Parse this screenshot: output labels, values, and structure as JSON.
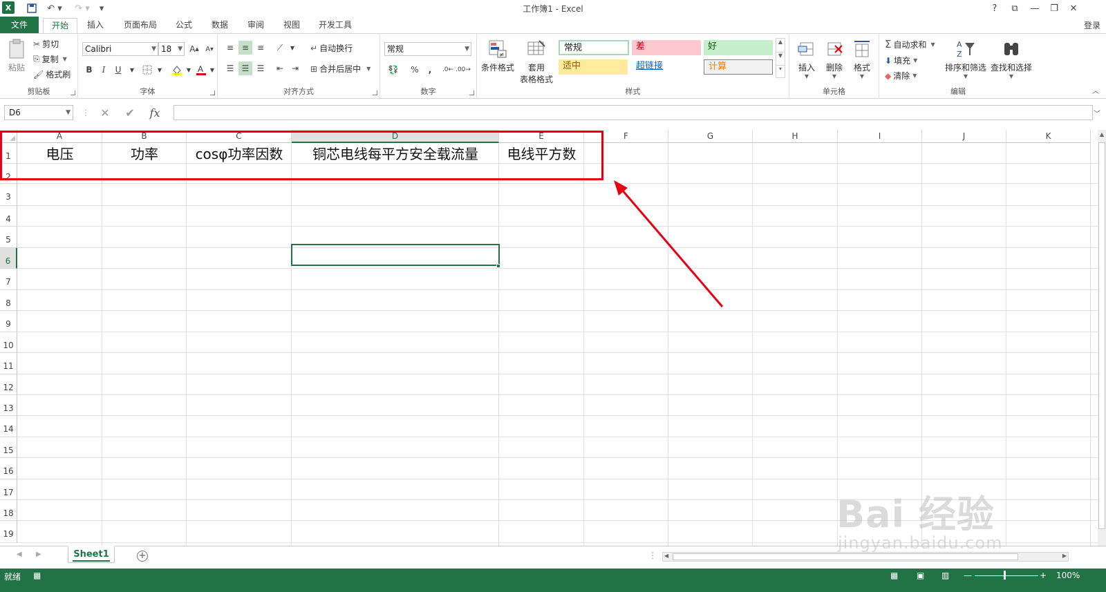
{
  "window": {
    "title": "工作簿1 - Excel",
    "controls": [
      "?",
      "⧉",
      "—",
      "❐",
      "✕"
    ]
  },
  "tabs": {
    "file": "文件",
    "items": [
      "开始",
      "插入",
      "页面布局",
      "公式",
      "数据",
      "审阅",
      "视图",
      "开发工具"
    ],
    "active": "开始",
    "login": "登录"
  },
  "ribbon": {
    "clipboard": {
      "label": "剪贴板",
      "paste": "粘贴",
      "cut": "剪切",
      "copy": "复制",
      "format_painter": "格式刷"
    },
    "font": {
      "label": "字体",
      "name": "Calibri",
      "size": "18",
      "bold": "B",
      "italic": "I",
      "underline": "U"
    },
    "alignment": {
      "label": "对齐方式",
      "wrap": "自动换行",
      "merge": "合并后居中"
    },
    "number": {
      "label": "数字",
      "format": "常规",
      "percent": "%",
      "comma": ","
    },
    "styles": {
      "label": "样式",
      "conditional": "条件格式",
      "table_format_1": "套用",
      "table_format_2": "表格格式",
      "normal": "常规",
      "bad": "差",
      "good": "好",
      "neutral": "适中",
      "hyperlink": "超链接",
      "calc": "计算"
    },
    "cells": {
      "label": "单元格",
      "insert": "插入",
      "delete": "删除",
      "format": "格式"
    },
    "editing": {
      "label": "编辑",
      "autosum": "自动求和",
      "fill": "填充",
      "clear": "清除",
      "sort": "排序和筛选",
      "find": "查找和选择"
    }
  },
  "formula_bar": {
    "name_box": "D6",
    "fx": "fx",
    "content": ""
  },
  "grid": {
    "columns": [
      "A",
      "B",
      "C",
      "D",
      "E",
      "F",
      "G",
      "H",
      "I",
      "J",
      "K"
    ],
    "rows": [
      "1",
      "2",
      "3",
      "4",
      "5",
      "6",
      "7",
      "8",
      "9",
      "10",
      "11",
      "12",
      "13",
      "14",
      "15",
      "16",
      "17",
      "18",
      "19"
    ],
    "active_cell": "D6",
    "row1": [
      "电压",
      "功率",
      "cosφ功率因数",
      "铜芯电线每平方安全载流量",
      "电线平方数"
    ]
  },
  "sheet_tabs": {
    "active": "Sheet1",
    "add": "+"
  },
  "status": {
    "ready": "就绪",
    "zoom": "100%"
  },
  "colors": {
    "excel_green": "#217346",
    "highlight_red": "#e60012"
  },
  "watermark": {
    "main": "Bai 经验",
    "sub": "jingyan.baidu.com"
  }
}
